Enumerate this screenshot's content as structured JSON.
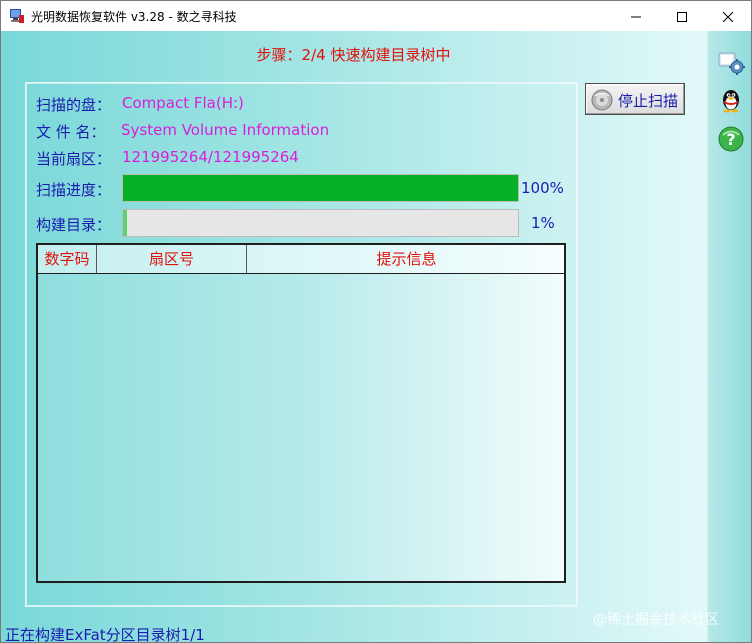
{
  "window": {
    "title": "光明数据恢复软件 v3.28 - 数之寻科技",
    "icons": {
      "app": "monitor-disk-icon",
      "minimize": "minimize-icon",
      "maximize": "maximize-icon",
      "close": "close-icon"
    }
  },
  "step": {
    "title": "步骤：2/4 快速构建目录树中"
  },
  "scan": {
    "disk_label": "扫描的盘：",
    "disk_value": "Compact Fla(H:)",
    "file_label": "文 件 名：",
    "file_value": "System Volume Information",
    "sector_label": "当前扇区：",
    "sector_value": "121995264/121995264",
    "progress_label": "扫描进度：",
    "progress_text": "100%",
    "progress_fraction": 1.0,
    "build_label": "构建目录：",
    "build_text": "1%",
    "build_fraction": 0.01
  },
  "table": {
    "columns": [
      "数字码",
      "扇区号",
      "提示信息"
    ],
    "rows": []
  },
  "actions": {
    "stop_label": "停止扫描",
    "stop_icon": "stop-disc-icon"
  },
  "sidebar": {
    "icons": [
      "settings-gear-icon",
      "qq-penguin-icon",
      "help-question-icon"
    ]
  },
  "status": {
    "text": "正在构建ExFat分区目录树1/1"
  },
  "watermark": {
    "text": "@稀土掘金技术社区"
  },
  "colors": {
    "accent_red": "#e0100a",
    "label_blue": "#1b1bb0",
    "value_magenta": "#d91ed8",
    "progress_green": "#06b025"
  }
}
